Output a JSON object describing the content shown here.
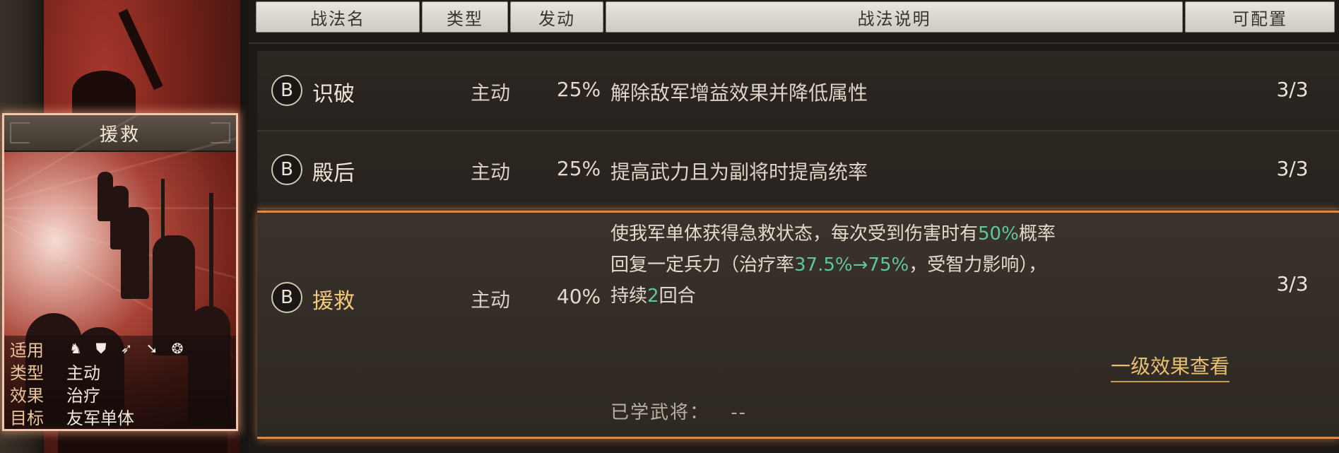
{
  "table": {
    "headers": {
      "name": "战法名",
      "type": "类型",
      "trigger": "发动",
      "description": "战法说明",
      "configurable": "可配置"
    },
    "rows": [
      {
        "grade": "B",
        "name": "识破",
        "type": "主动",
        "rate": "25%",
        "description": "解除敌军增益效果并降低属性",
        "slots": "3/3"
      },
      {
        "grade": "B",
        "name": "殿后",
        "type": "主动",
        "rate": "25%",
        "description": "提高武力且为副将时提高统率",
        "slots": "3/3"
      }
    ],
    "selected": {
      "grade": "B",
      "name": "援救",
      "type": "主动",
      "rate": "40%",
      "slots": "3/3",
      "desc_line1_a": "使我军单体获得急救状态，每次受到伤害时有",
      "desc_line1_hl": "50%",
      "desc_line1_b": "概率",
      "desc_line2_a": "回复一定兵力（治疗率",
      "desc_line2_hl": "37.5%→75%",
      "desc_line2_b": "，受智力影响），",
      "desc_line3_a": "持续",
      "desc_line3_hl": "2",
      "desc_line3_b": "回合",
      "level_link": "一级效果查看",
      "learned_label": "已学武将：",
      "learned_value": "--"
    }
  },
  "card": {
    "title": "援救",
    "props": [
      {
        "key": "适用",
        "value": ""
      },
      {
        "key": "类型",
        "value": "主动"
      },
      {
        "key": "效果",
        "value": "治疗"
      },
      {
        "key": "目标",
        "value": "友军单体"
      }
    ],
    "troop_icons": [
      "cavalry-icon",
      "shield-icon",
      "bow-icon",
      "spear-icon",
      "wheel-icon"
    ]
  },
  "colors": {
    "accent_orange": "#d58a4f",
    "highlight_green": "#5fc79a",
    "selected_name": "#f0c97a"
  }
}
